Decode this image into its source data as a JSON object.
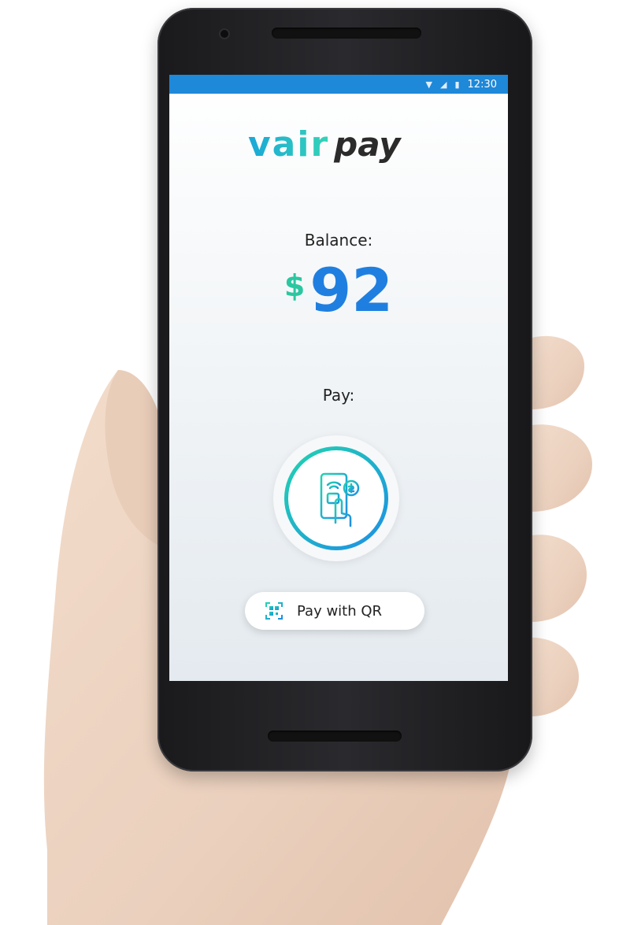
{
  "status_bar": {
    "time": "12:30"
  },
  "logo": {
    "brand": "vair",
    "suffix": "pay"
  },
  "balance": {
    "label": "Balance:",
    "currency": "$",
    "amount": "92"
  },
  "pay": {
    "label": "Pay:",
    "nfc_icon": "tap-to-pay-icon"
  },
  "qr_button": {
    "label": "Pay with QR",
    "icon": "qr-code-icon"
  },
  "colors": {
    "status_bar": "#1e88d9",
    "accent_blue": "#1f7fe0",
    "accent_green": "#2bc7a0"
  }
}
